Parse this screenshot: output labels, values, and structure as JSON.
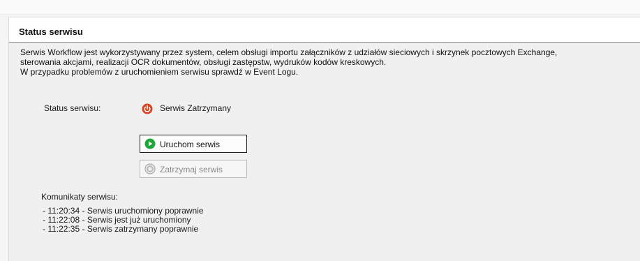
{
  "service_panel": {
    "title": "Status serwisu",
    "description_lines": [
      "Serwis Workflow jest wykorzystywany przez system, celem obsługi importu załączników z udziałów sieciowych i skrzynek pocztowych Exchange,",
      "sterowania akcjami, realizacji OCR dokumentów, obsługi zastępstw, wydruków kodów kreskowych.",
      "W przypadku problemów z uruchomieniem serwisu sprawdź w Event Logu."
    ],
    "status_label": "Status serwisu:",
    "status_value": "Serwis Zatrzymany",
    "status_icon": "power-stopped-icon",
    "start_button_label": "Uruchom serwis",
    "start_button_icon": "play-icon",
    "stop_button_label": "Zatrzymaj serwis",
    "stop_button_icon": "stop-icon",
    "stop_button_enabled": false,
    "log_label": "Komunikaty serwisu:",
    "log_messages": [
      "- 11:20:34 - Serwis uruchomiony poprawnie",
      "- 11:22:08 - Serwis jest już uruchomiony",
      "- 11:22:35 - Serwis zatrzymany poprawnie"
    ]
  },
  "colors": {
    "status_stopped": "#d9411e",
    "start_icon": "#1fa83a",
    "disabled_icon": "#a8a8a8"
  }
}
